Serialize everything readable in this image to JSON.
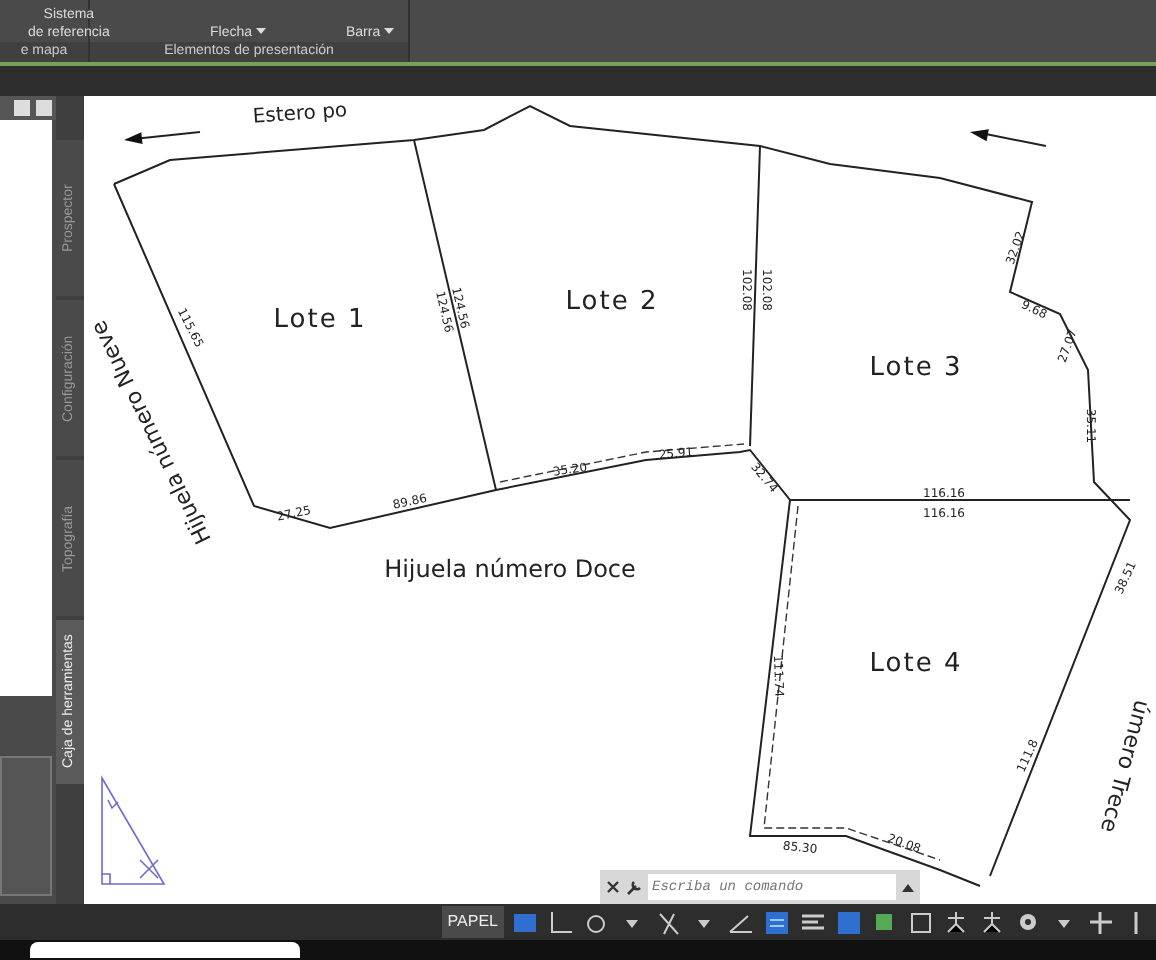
{
  "ribbon": {
    "buttons": [
      {
        "lines": [
          "Sistema",
          "de referencia"
        ],
        "dropdown": false
      },
      {
        "lines": [
          "Flecha"
        ],
        "dropdown": true
      },
      {
        "lines": [
          "Barra"
        ],
        "dropdown": true
      }
    ],
    "panel_titles": [
      "e mapa",
      "Elementos de presentación"
    ]
  },
  "palette_tabs": [
    {
      "label": "Prospector",
      "selected": false
    },
    {
      "label": "Configuración",
      "selected": false
    },
    {
      "label": "Topografía",
      "selected": false
    },
    {
      "label": "Caja de herramientas",
      "selected": true
    }
  ],
  "drawing": {
    "labels": [
      {
        "kind": "road",
        "text": "Estero po"
      },
      {
        "kind": "lot",
        "text": "Lote 1"
      },
      {
        "kind": "lot",
        "text": "Lote 2"
      },
      {
        "kind": "lot",
        "text": "Lote 3"
      },
      {
        "kind": "lot",
        "text": "Lote 4"
      },
      {
        "kind": "road",
        "text": "Hijuela número Nueve"
      },
      {
        "kind": "road",
        "text": "Hijuela número Doce"
      },
      {
        "kind": "road",
        "text": "úmero Trece"
      },
      {
        "kind": "dimension",
        "text": "115.65"
      },
      {
        "kind": "dimension",
        "text": "27.25"
      },
      {
        "kind": "dimension",
        "text": "89.86"
      },
      {
        "kind": "dimension",
        "text": "124.56"
      },
      {
        "kind": "dimension",
        "text": "124.56"
      },
      {
        "kind": "dimension",
        "text": "35.20"
      },
      {
        "kind": "dimension",
        "text": "25.91"
      },
      {
        "kind": "dimension",
        "text": "102.08"
      },
      {
        "kind": "dimension",
        "text": "102.08"
      },
      {
        "kind": "dimension",
        "text": "32.74"
      },
      {
        "kind": "dimension",
        "text": "32.02"
      },
      {
        "kind": "dimension",
        "text": "9.68"
      },
      {
        "kind": "dimension",
        "text": "27.07"
      },
      {
        "kind": "dimension",
        "text": "35.11"
      },
      {
        "kind": "dimension",
        "text": "116.16"
      },
      {
        "kind": "dimension",
        "text": "116.16"
      },
      {
        "kind": "dimension",
        "text": "38.51"
      },
      {
        "kind": "dimension",
        "text": "111.74"
      },
      {
        "kind": "dimension",
        "text": "111.8"
      },
      {
        "kind": "dimension",
        "text": "85.30"
      },
      {
        "kind": "dimension",
        "text": "20.08"
      }
    ]
  },
  "command_line": {
    "placeholder": "Escriba un comando"
  },
  "status_bar": {
    "mode": "PAPEL"
  }
}
